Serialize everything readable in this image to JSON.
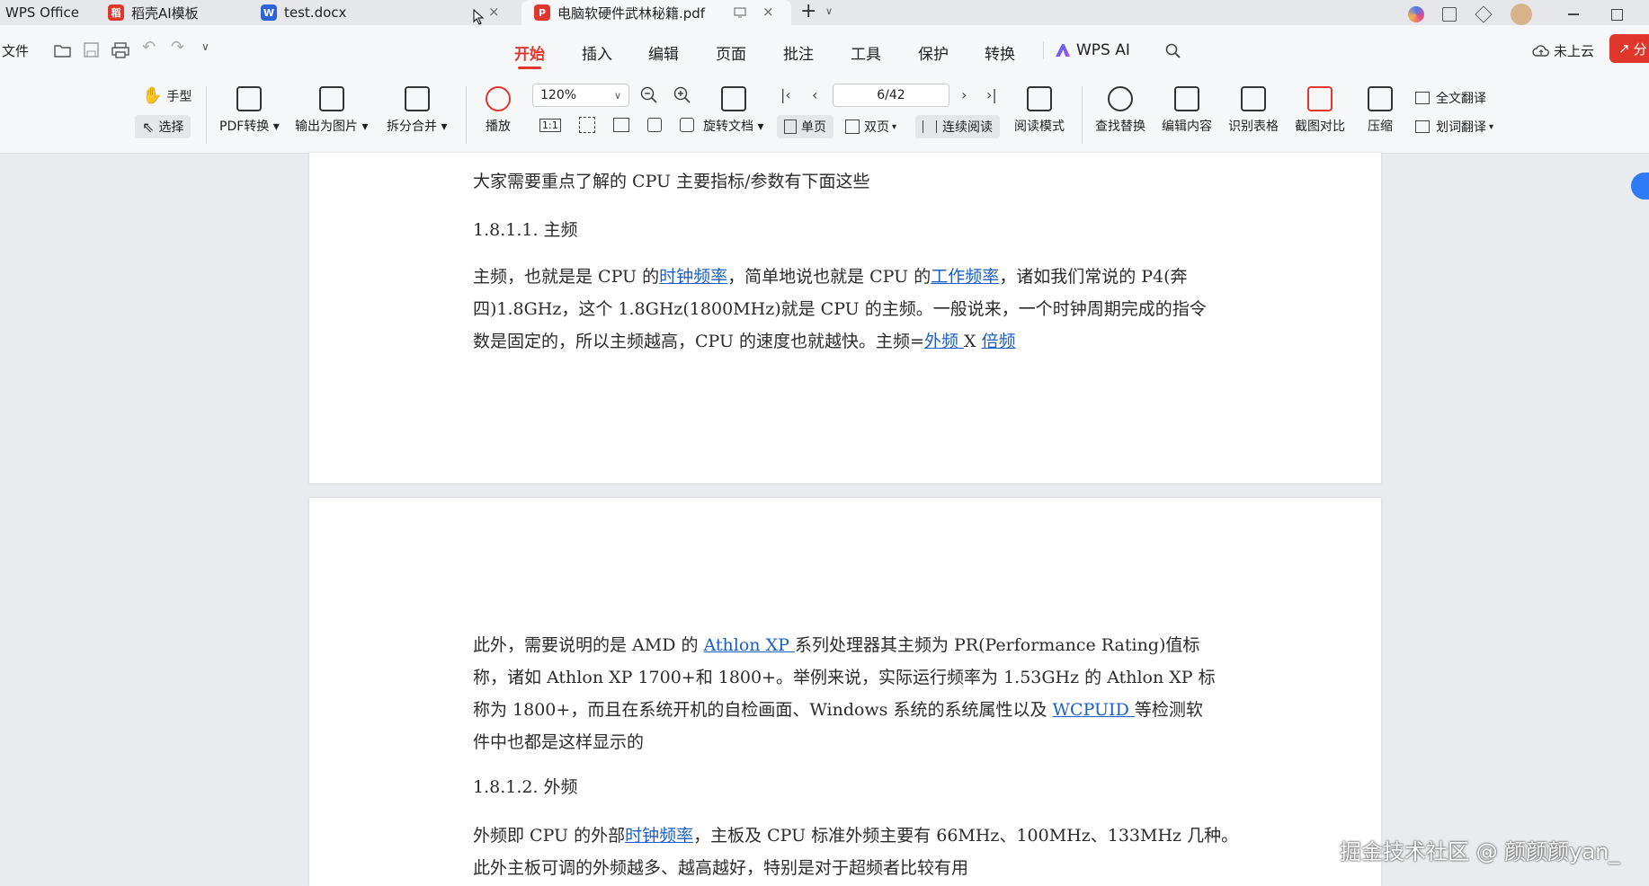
{
  "titlebar": {
    "app_name": "WPS Office",
    "tabs": [
      {
        "label": "稻壳AI模板"
      },
      {
        "label": "test.docx"
      },
      {
        "label": "电脑软硬件武林秘籍.pdf"
      }
    ],
    "close_glyph": "×",
    "add_glyph": "+",
    "dropdown_glyph": "∨"
  },
  "menubar": {
    "file_label": "文件",
    "items": [
      "开始",
      "插入",
      "编辑",
      "页面",
      "批注",
      "工具",
      "保护",
      "转换"
    ],
    "wps_ai_label": "WPS AI",
    "cloud_label": "未上云",
    "share_label": "分"
  },
  "toolbar": {
    "hand_label": "手型",
    "select_label": "选择",
    "pdf_convert_label": "PDF转换",
    "export_image_label": "输出为图片",
    "split_merge_label": "拆分合并",
    "play_label": "播放",
    "zoom_value": "120%",
    "rotate_label": "旋转文档",
    "page_value": "6/42",
    "single_page_label": "单页",
    "double_page_label": "双页",
    "continuous_label": "连续阅读",
    "read_mode_label": "阅读模式",
    "find_replace_label": "查找替换",
    "edit_content_label": "编辑内容",
    "recognize_table_label": "识别表格",
    "screenshot_compare_label": "截图对比",
    "compress_label": "压缩",
    "full_translate_label": "全文翻译",
    "word_translate_label": "划词翻译",
    "fit_label": "1:1"
  },
  "document": {
    "p1": "大家需要重点了解的 CPU 主要指标/参数有下面这些",
    "h1": "1.8.1.1. 主频",
    "p2_a": "主频，也就是是 CPU 的",
    "p2_link1": "时钟频率",
    "p2_b": "，简单地说也就是 CPU 的",
    "p2_link2": "工作频率",
    "p2_c": "，诸如我们常说的 P4(奔",
    "p2_line2": "四)1.8GHz，这个 1.8GHz(1800MHz)就是 CPU 的主频。一般说来，一个时钟周期完成的指令",
    "p2_line3_a": "数是固定的，所以主频越高，CPU 的速度也就越快。主频=",
    "p2_link3": "外频 ",
    "p2_line3_b": "X ",
    "p2_link4": "倍频",
    "p3_a": "此外，需要说明的是 AMD 的 ",
    "p3_link1": "Athlon XP ",
    "p3_b": "系列处理器其主频为 PR(Performance Rating)值标",
    "p3_line2": "称，诸如 Athlon XP 1700+和 1800+。举例来说，实际运行频率为 1.53GHz 的 Athlon XP 标",
    "p3_line3_a": "称为 1800+，而且在系统开机的自检画面、Windows 系统的系统属性以及 ",
    "p3_link2": "WCPUID ",
    "p3_line3_b": "等检测软",
    "p3_line4": "件中也都是这样显示的",
    "h2": "1.8.1.2. 外频",
    "p4_a": "外频即 CPU 的外部",
    "p4_link": "时钟频率",
    "p4_b": "，主板及 CPU 标准外频主要有 66MHz、100MHz、133MHz 几种。",
    "p4_line2": "此外主板可调的外频越多、越高越好，特别是对于超频者比较有用"
  },
  "watermark": "掘金技术社区 @ 颜颜颜yan_"
}
